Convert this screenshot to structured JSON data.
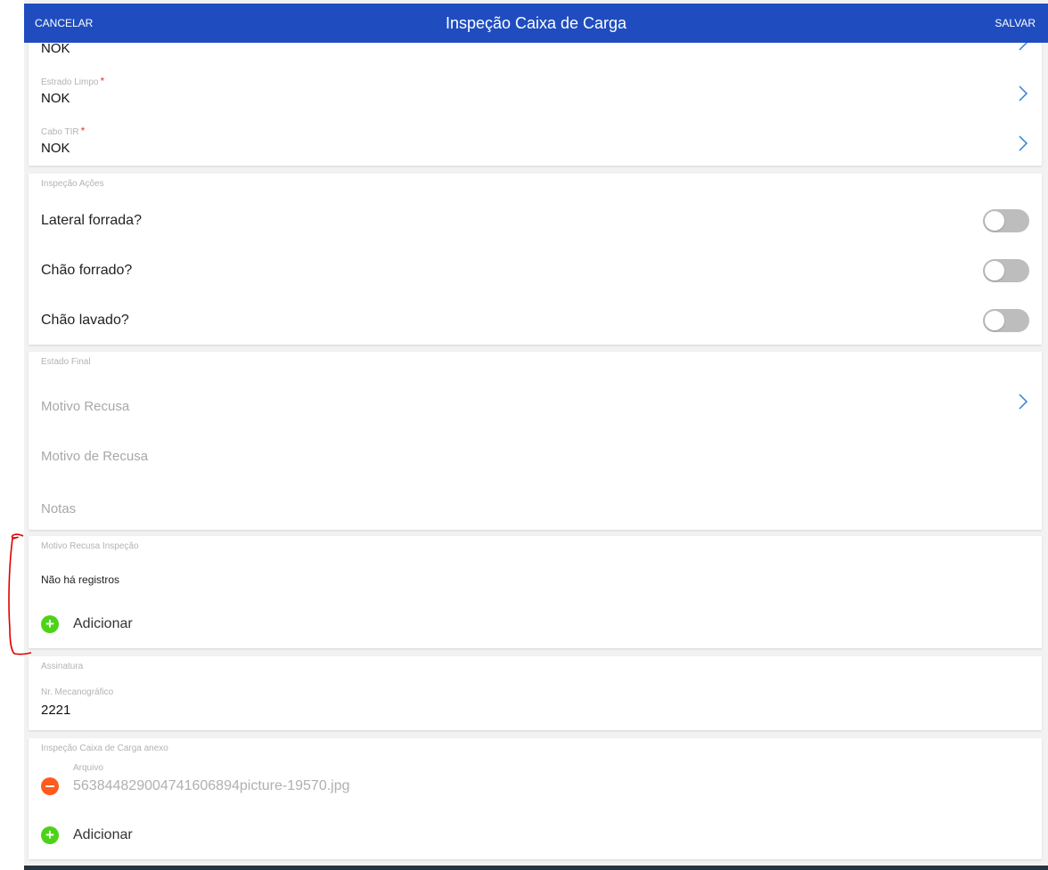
{
  "header": {
    "cancel_label": "CANCELAR",
    "title": "Inspeção Caixa de Carga",
    "save_label": "SALVAR"
  },
  "fields_top": {
    "partial_value": "NOK",
    "estrado_label": "Estrado Limpo",
    "estrado_required": "*",
    "estrado_value": "NOK",
    "cabo_label": "Cabo TIR",
    "cabo_required": "*",
    "cabo_value": "NOK"
  },
  "inspecao_acoes": {
    "section_title": "Inspeção Ações",
    "items": [
      {
        "label": "Lateral forrada?",
        "on": false
      },
      {
        "label": "Chão forrado?",
        "on": false
      },
      {
        "label": "Chão lavado?",
        "on": false
      }
    ]
  },
  "estado_final": {
    "section_title": "Estado Final",
    "motivo_recusa_placeholder": "Motivo Recusa",
    "motivo_de_recusa_placeholder": "Motivo de Recusa",
    "notas_placeholder": "Notas"
  },
  "motivo_recusa_inspecao": {
    "section_title": "Motivo Recusa Inspeção",
    "empty_text": "Não há registros",
    "add_label": "Adicionar"
  },
  "assinatura": {
    "section_title": "Assinatura",
    "field_label": "Nr. Mecanográfico",
    "field_value": "2221"
  },
  "anexo": {
    "section_title": "Inspeção Caixa de Carga anexo",
    "file_label": "Arquivo",
    "file_name": "5638448290047416068​94picture-19570.jpg",
    "add_label": "Adicionar"
  },
  "colors": {
    "header_bg": "#1f4dbf",
    "chevron": "#2f7fd8",
    "required": "#e53935",
    "add_icon": "#4cd318",
    "remove_icon": "#ff5a1f",
    "annotation": "#e00000"
  },
  "icons": [
    "chevron-right-icon",
    "plus-circle-icon",
    "minus-circle-icon"
  ]
}
